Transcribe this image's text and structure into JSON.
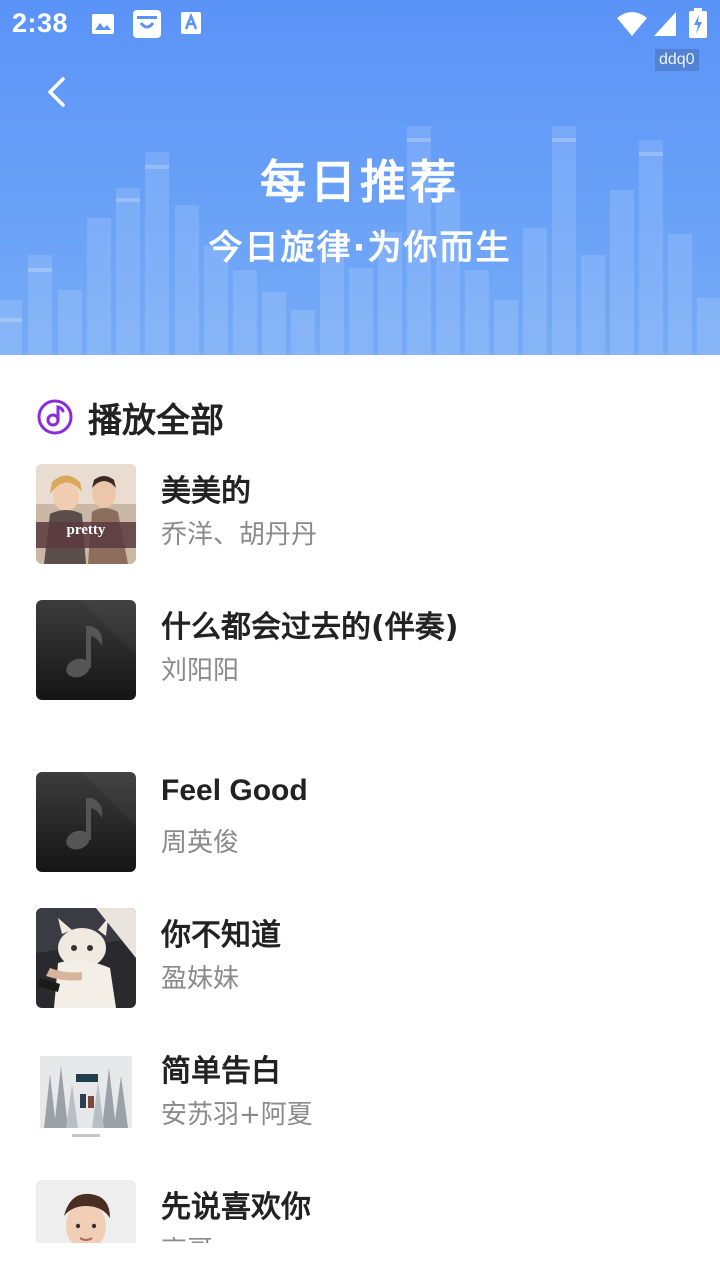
{
  "status_bar": {
    "time": "2:38",
    "left_icons": [
      "image-icon",
      "shopping-bag-icon",
      "font-a-icon"
    ],
    "right_icons": [
      "wifi-icon",
      "signal-icon",
      "battery-icon"
    ]
  },
  "watermark": "ddq0",
  "header": {
    "title": "每日推荐",
    "subtitle": "今日旋律·为你而生",
    "bg_color": "#6aa2f7"
  },
  "play_all": {
    "label": "播放全部",
    "icon": "music-disc-icon",
    "accent": "#8a2be2"
  },
  "songs": [
    {
      "title": "美美的",
      "artist": "乔洋、胡丹丹",
      "cover": "photo-pretty",
      "cover_text": "pretty"
    },
    {
      "title": "什么都会过去的(伴奏)",
      "artist": "刘阳阳",
      "cover": "placeholder-note"
    },
    {
      "title": "Feel Good",
      "artist": "周英俊",
      "cover": "placeholder-note"
    },
    {
      "title": "你不知道",
      "artist": "盈妹妹",
      "cover": "photo-cat"
    },
    {
      "title": "简单告白",
      "artist": "安苏羽+阿夏",
      "cover": "photo-forest"
    },
    {
      "title": "先说喜欢你",
      "artist": "高哥",
      "cover": "photo-portrait"
    }
  ]
}
